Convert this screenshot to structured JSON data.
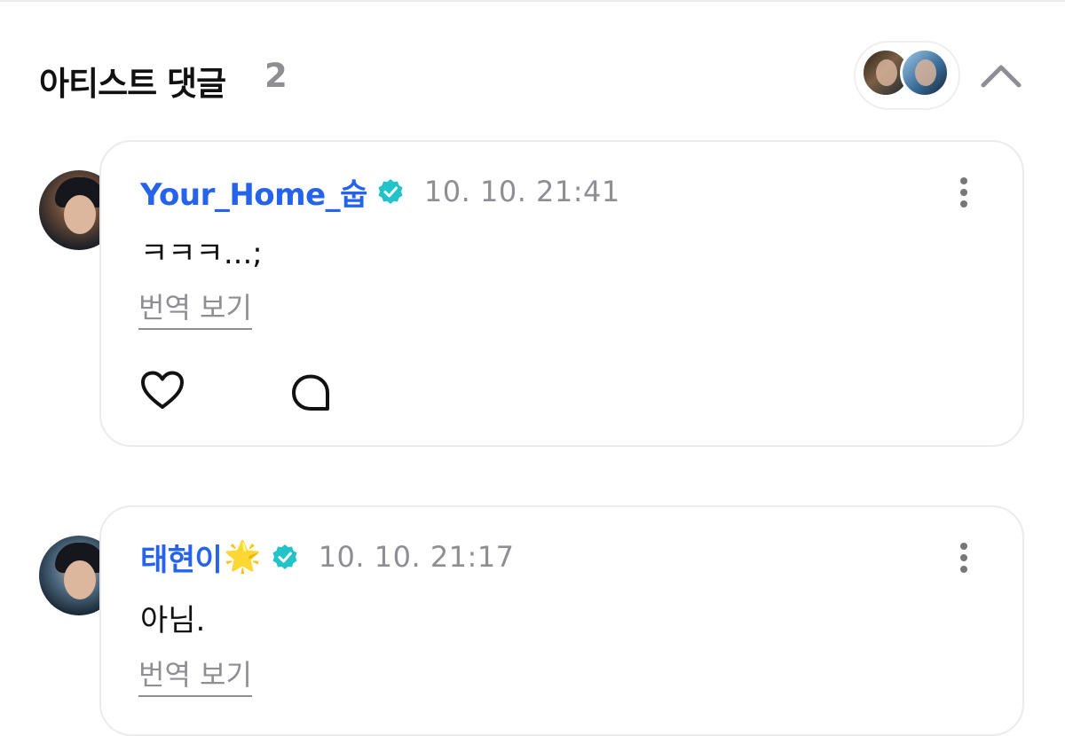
{
  "header": {
    "title": "아티스트 댓글",
    "count": "2",
    "avatar_stack": [
      "avatar-1",
      "avatar-2"
    ],
    "collapse_icon": "chevron-up-icon"
  },
  "comments": [
    {
      "username": "Your_Home_숩",
      "badge_emoji": "",
      "verified_icon": "verified-badge-icon",
      "timestamp": "10. 10. 21:41",
      "text": "ㅋㅋㅋ...;",
      "translate_label": "번역 보기",
      "actions": [
        "heart-icon",
        "comment-bubble-icon"
      ]
    },
    {
      "username": "태현이",
      "badge_emoji": "🌟",
      "verified_icon": "verified-badge-icon",
      "timestamp": "10. 10. 21:17",
      "text": "아님.",
      "translate_label": "번역 보기"
    }
  ],
  "colors": {
    "username": "#2563eb",
    "verified": "#22c3c9",
    "muted": "#8e8e93",
    "card_border": "#ebebef"
  }
}
